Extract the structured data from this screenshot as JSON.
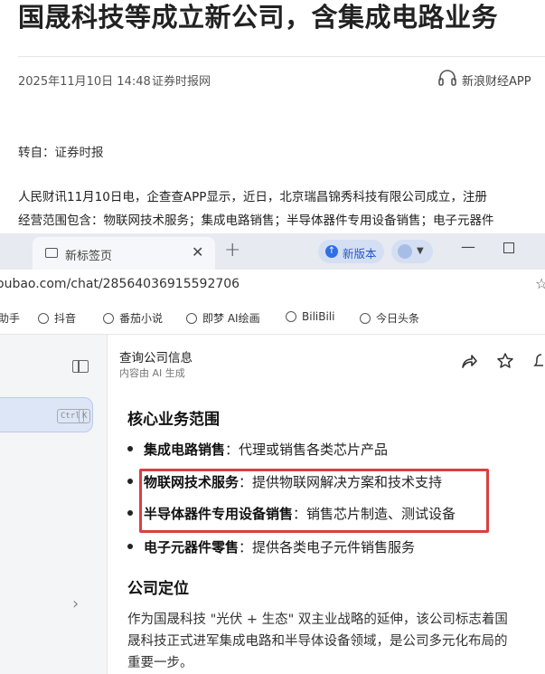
{
  "article": {
    "title": "国晟科技等成立新公司，含集成电路业务",
    "date": "2025年11月10日 14:48",
    "source": "证券时报网",
    "app_label": "新浪财经APP",
    "transfer": "转自：证券时报",
    "para1": "人民财讯11月10日电，企查查APP显示，近日，北京瑞昌锦秀科技有限公司成立，注册",
    "para2": "经营范围包含：物联网技术服务；集成电路销售；半导体器件专用设备销售；电子元器件"
  },
  "browser": {
    "tab_label": "新标签页",
    "tab_close": "✕",
    "new_tab": "+",
    "update_label": "新版本",
    "url": "oubao.com/chat/28564036915592706",
    "bookmarks": [
      "助手",
      "抖音",
      "番茄小说",
      "即梦 AI绘画",
      "BiliBili",
      "今日头条"
    ],
    "sidebar_kbd": [
      "Ctrl",
      "K"
    ]
  },
  "chat": {
    "title": "查询公司信息",
    "subtitle": "内容由 AI 生成",
    "section1": "核心业务范围",
    "items": [
      {
        "bold": "集成电路销售",
        "rest": "：代理或销售各类芯片产品"
      },
      {
        "bold": "物联网技术服务",
        "rest": "：提供物联网解决方案和技术支持"
      },
      {
        "bold": "半导体器件专用设备销售",
        "rest": "：销售芯片制造、测试设备"
      },
      {
        "bold": "电子元器件零售",
        "rest": "：提供各类电子元件销售服务"
      }
    ],
    "section2": "公司定位",
    "body": [
      "作为国晟科技 \"光伏 + 生态\" 双主业战略的延伸，该公司标志着国",
      "晟科技正式进军集成电路和半导体设备领域，是公司多元化布局的",
      "重要一步。"
    ]
  },
  "colors": {
    "highlight": "#d9403e",
    "accent": "#2f6fe4"
  }
}
